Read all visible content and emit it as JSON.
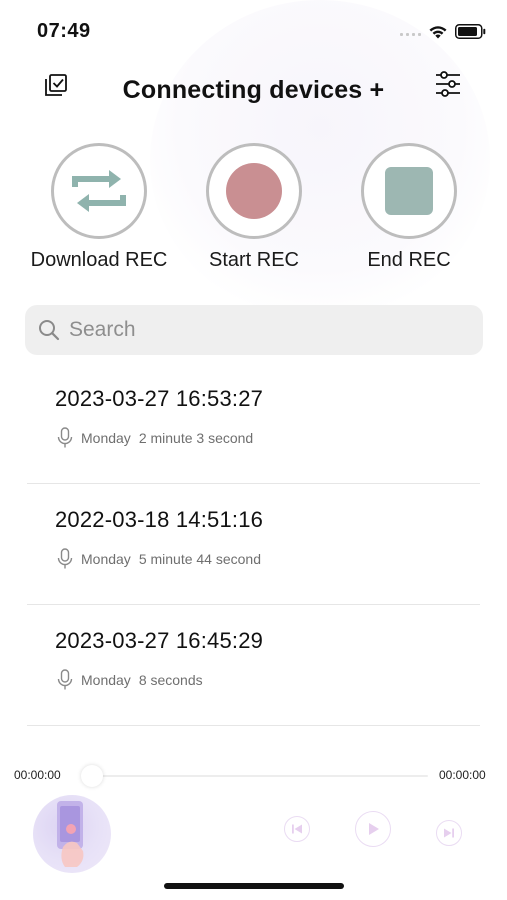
{
  "status_bar": {
    "time": "07:49"
  },
  "header": {
    "title": "Connecting devices +"
  },
  "actions": [
    {
      "label": "Download REC",
      "icon": "sync-arrows-icon"
    },
    {
      "label": "Start REC",
      "icon": "record-dot-icon"
    },
    {
      "label": "End REC",
      "icon": "stop-square-icon"
    }
  ],
  "search": {
    "placeholder": "Search",
    "value": ""
  },
  "recordings": [
    {
      "title": "2023-03-27 16:53:27",
      "day": "Monday",
      "duration": "2 minute 3 second"
    },
    {
      "title": "2022-03-18 14:51:16",
      "day": "Monday",
      "duration": "5 minute 44 second"
    },
    {
      "title": "2023-03-27 16:45:29",
      "day": "Monday",
      "duration": "8 seconds"
    }
  ],
  "player": {
    "elapsed": "00:00:00",
    "total": "00:00:00",
    "progress": 0
  },
  "colors": {
    "record": "#c98f92",
    "stop": "#9db7b2",
    "sync": "#8fb3ad",
    "accent_controls": "#eadcf3"
  }
}
